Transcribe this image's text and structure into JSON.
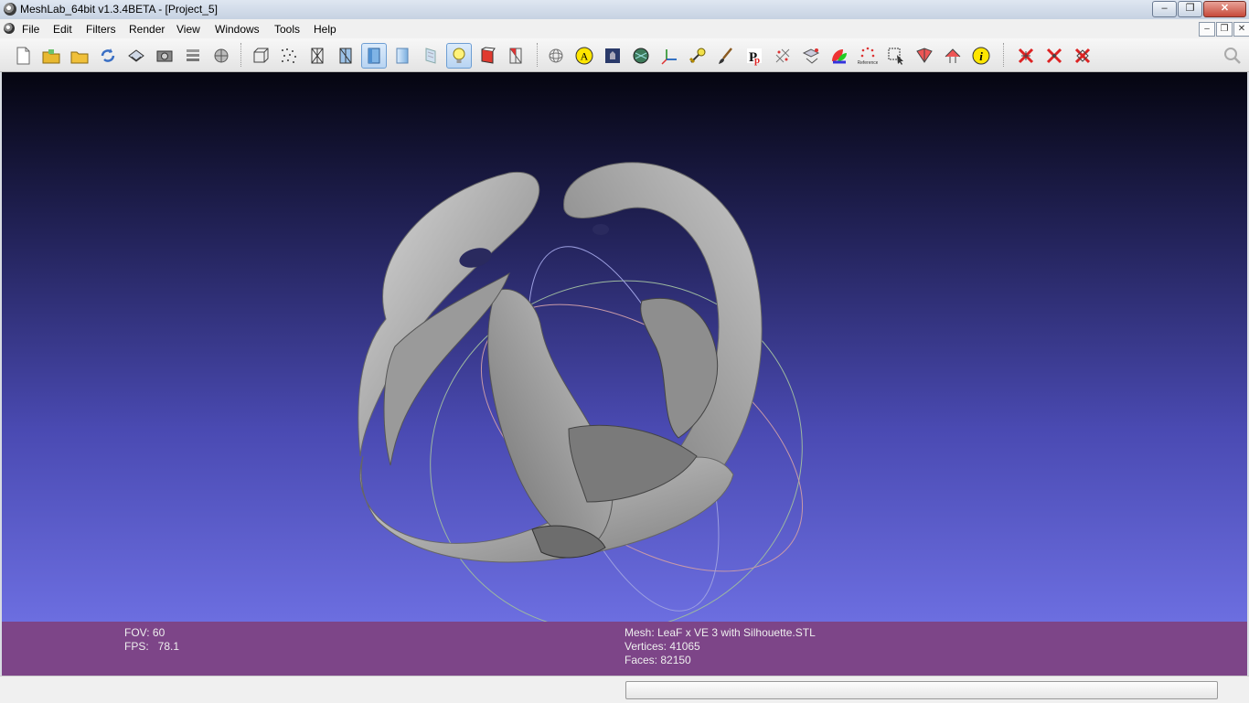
{
  "window": {
    "title": "MeshLab_64bit v1.3.4BETA - [Project_5]"
  },
  "window_controls": {
    "minimize": "–",
    "maximize": "❐",
    "close": "✕"
  },
  "mdi_controls": {
    "minimize": "–",
    "restore": "❐",
    "close": "✕"
  },
  "menu": [
    "File",
    "Edit",
    "Filters",
    "Render",
    "View",
    "Windows",
    "Tools",
    "Help"
  ],
  "toolbar": {
    "icons": [
      "new-project-icon",
      "open-project-icon",
      "open-mesh-icon",
      "reload-icon",
      "save-icon",
      "snapshot-icon",
      "layers-icon",
      "raster-layers-icon",
      "bounding-box-icon",
      "points-icon",
      "wireframe-icon",
      "hidden-lines-icon",
      "flat-shading-icon",
      "smooth-shading-icon",
      "texture-icon",
      "light-icon",
      "back-face-icon",
      "selected-faces-icon",
      "trackball-icon",
      "annotation-icon",
      "align-icon",
      "paint-icon",
      "axis-icon",
      "measure-icon",
      "brush-icon",
      "pickpoints-icon",
      "select-vertices-icon",
      "manipulate-icon",
      "color-icon",
      "reference-icon",
      "select-region-icon",
      "select-faces-icon",
      "select-connected-icon",
      "info-icon",
      "delete-faces-icon",
      "delete-vertices-icon",
      "delete-all-icon",
      "search-icon"
    ]
  },
  "viewport": {
    "background_top": "#050510",
    "background_bottom": "#6c6ee0"
  },
  "info": {
    "fov": "FOV: 60",
    "fps": "FPS:   78.1",
    "mesh": "Mesh: LeaF x VE 3 with Silhouette.STL",
    "vertices": "Vertices: 41065",
    "faces": "Faces: 82150"
  },
  "status": {
    "progress": 0
  }
}
